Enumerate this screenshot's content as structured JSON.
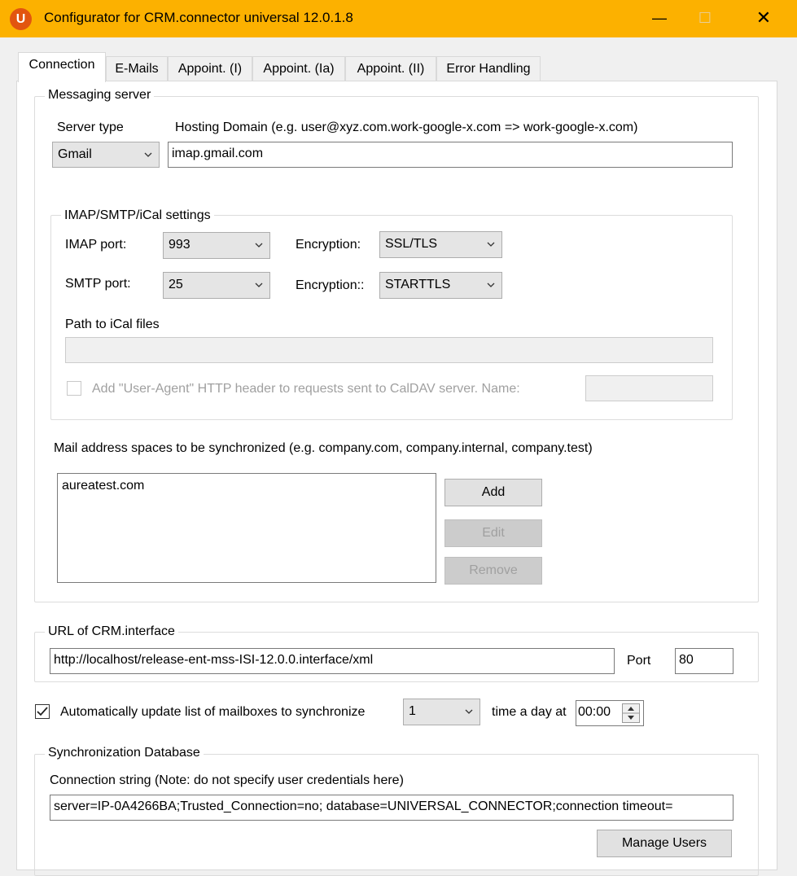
{
  "window": {
    "title": "Configurator for CRM.connector universal 12.0.1.8",
    "app_icon_letter": "U",
    "minimize": "—",
    "maximize": "☐",
    "close": "✕"
  },
  "tabs": [
    "Connection",
    "E-Mails",
    "Appoint. (I)",
    "Appoint. (Ia)",
    "Appoint. (II)",
    "Error Handling"
  ],
  "messaging_server": {
    "legend": "Messaging server",
    "server_type_label": "Server type",
    "server_type_value": "Gmail",
    "hosting_domain_label": "Hosting Domain (e.g. user@xyz.com.work-google-x.com => work-google-x.com)",
    "hosting_domain_value": "imap.gmail.com"
  },
  "imap": {
    "legend": "IMAP/SMTP/iCal settings",
    "imap_port_label": "IMAP port:",
    "imap_port_value": "993",
    "imap_encryption_label": "Encryption:",
    "imap_encryption_value": "SSL/TLS",
    "smtp_port_label": "SMTP port:",
    "smtp_port_value": "25",
    "smtp_encryption_label": "Encryption::",
    "smtp_encryption_value": "STARTTLS",
    "ical_path_label": "Path to iCal files",
    "ical_path_value": "",
    "user_agent_label": "Add \"User-Agent\" HTTP header to  requests sent to CalDAV server. Name:",
    "user_agent_value": ""
  },
  "mail_spaces": {
    "label": "Mail address spaces to be synchronized (e.g. company.com, company.internal, company.test)",
    "items": [
      "aureatest.com"
    ],
    "add": "Add",
    "edit": "Edit",
    "remove": "Remove"
  },
  "crm_interface": {
    "legend": "URL of CRM.interface",
    "url": "http://localhost/release-ent-mss-ISI-12.0.0.interface/xml",
    "port_label": "Port",
    "port_value": "80"
  },
  "auto_update": {
    "checked": true,
    "label": "Automatically update list of mailboxes to synchronize",
    "times_value": "1",
    "times_label": "time a day at",
    "time_value": "00:00"
  },
  "sync_db": {
    "legend": "Synchronization Database",
    "conn_label": "Connection string (Note: do not specify user credentials here)",
    "conn_value": "server=IP-0A4266BA;Trusted_Connection=no; database=UNIVERSAL_CONNECTOR;connection timeout=",
    "manage_users": "Manage Users"
  }
}
